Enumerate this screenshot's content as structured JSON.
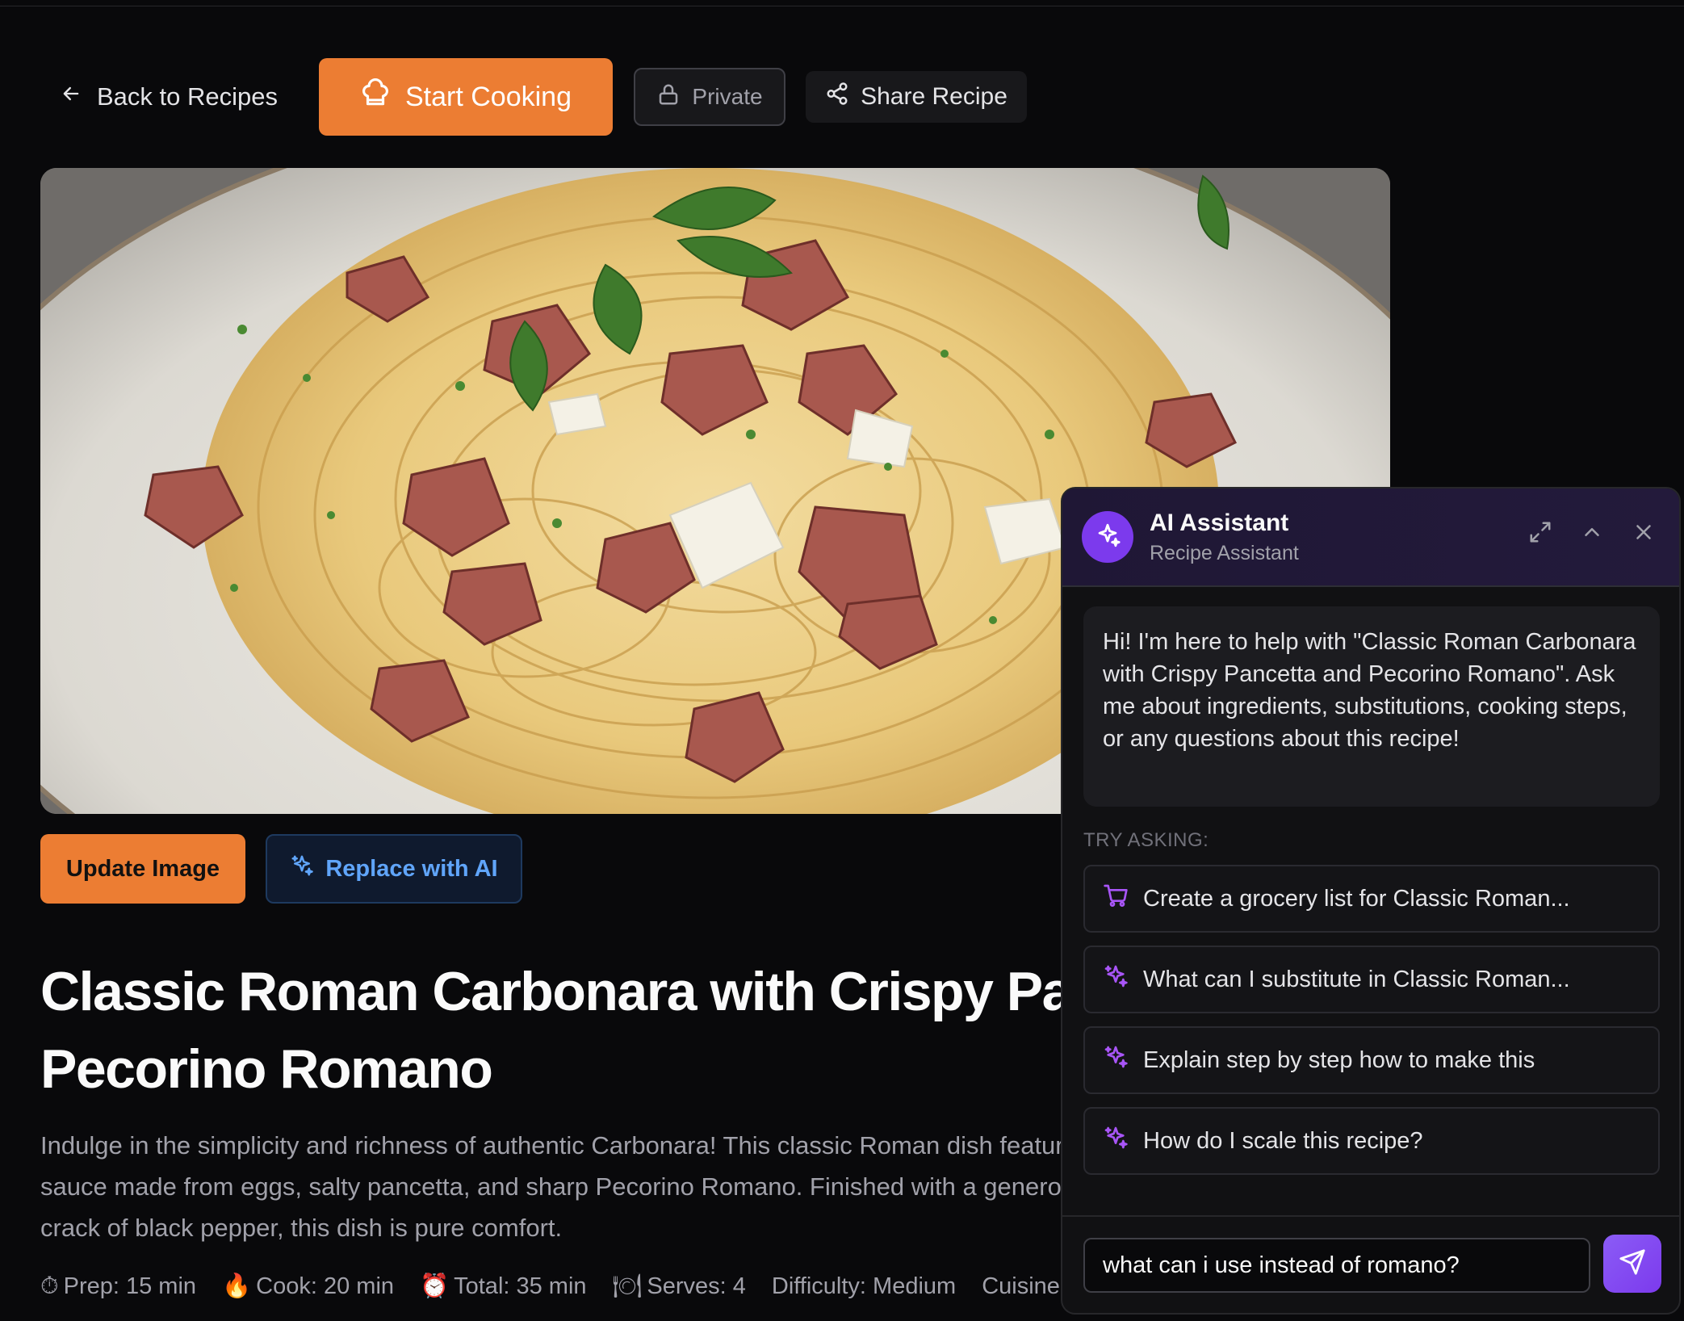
{
  "toolbar": {
    "back_label": "Back to Recipes",
    "start_label": "Start Cooking",
    "private_label": "Private",
    "share_label": "Share Recipe"
  },
  "image_actions": {
    "update_label": "Update Image",
    "replace_label": "Replace with AI"
  },
  "recipe": {
    "title": "Classic Roman Carbonara with Crispy Pancetta and Pecorino Romano",
    "description": "Indulge in the simplicity and richness of authentic Carbonara! This classic Roman dish features pasta coated in a creamy sauce made from eggs, salty pancetta, and sharp Pecorino Romano. Finished with a generous grating of cheese and a crack of black pepper, this dish is pure comfort.",
    "meta": {
      "prep": "Prep: 15 min",
      "cook": "Cook: 20 min",
      "total": "Total: 35 min",
      "serves": "Serves: 4",
      "difficulty": "Difficulty: Medium",
      "cuisine": "Cuisine: It"
    }
  },
  "assistant": {
    "title": "AI Assistant",
    "subtitle": "Recipe Assistant",
    "greeting": "Hi! I'm here to help with \"Classic Roman Carbonara with Crispy Pancetta and Pecorino Romano\". Ask me about ingredients, substitutions, cooking steps, or any questions about this recipe!",
    "try_label": "TRY ASKING:",
    "suggestions": [
      {
        "icon": "cart-icon",
        "text": "Create a grocery list for Classic Roman..."
      },
      {
        "icon": "sparkle-icon",
        "text": "What can I substitute in Classic Roman..."
      },
      {
        "icon": "sparkle-icon",
        "text": "Explain step by step how to make this"
      },
      {
        "icon": "sparkle-icon",
        "text": "How do I scale this recipe?"
      }
    ],
    "input_value": "what can i use instead of romano?"
  },
  "colors": {
    "accent_orange": "#ec7d33",
    "assistant_purple": "#7c3aed",
    "ai_blue": "#60a5fa",
    "background": "#09090b"
  }
}
